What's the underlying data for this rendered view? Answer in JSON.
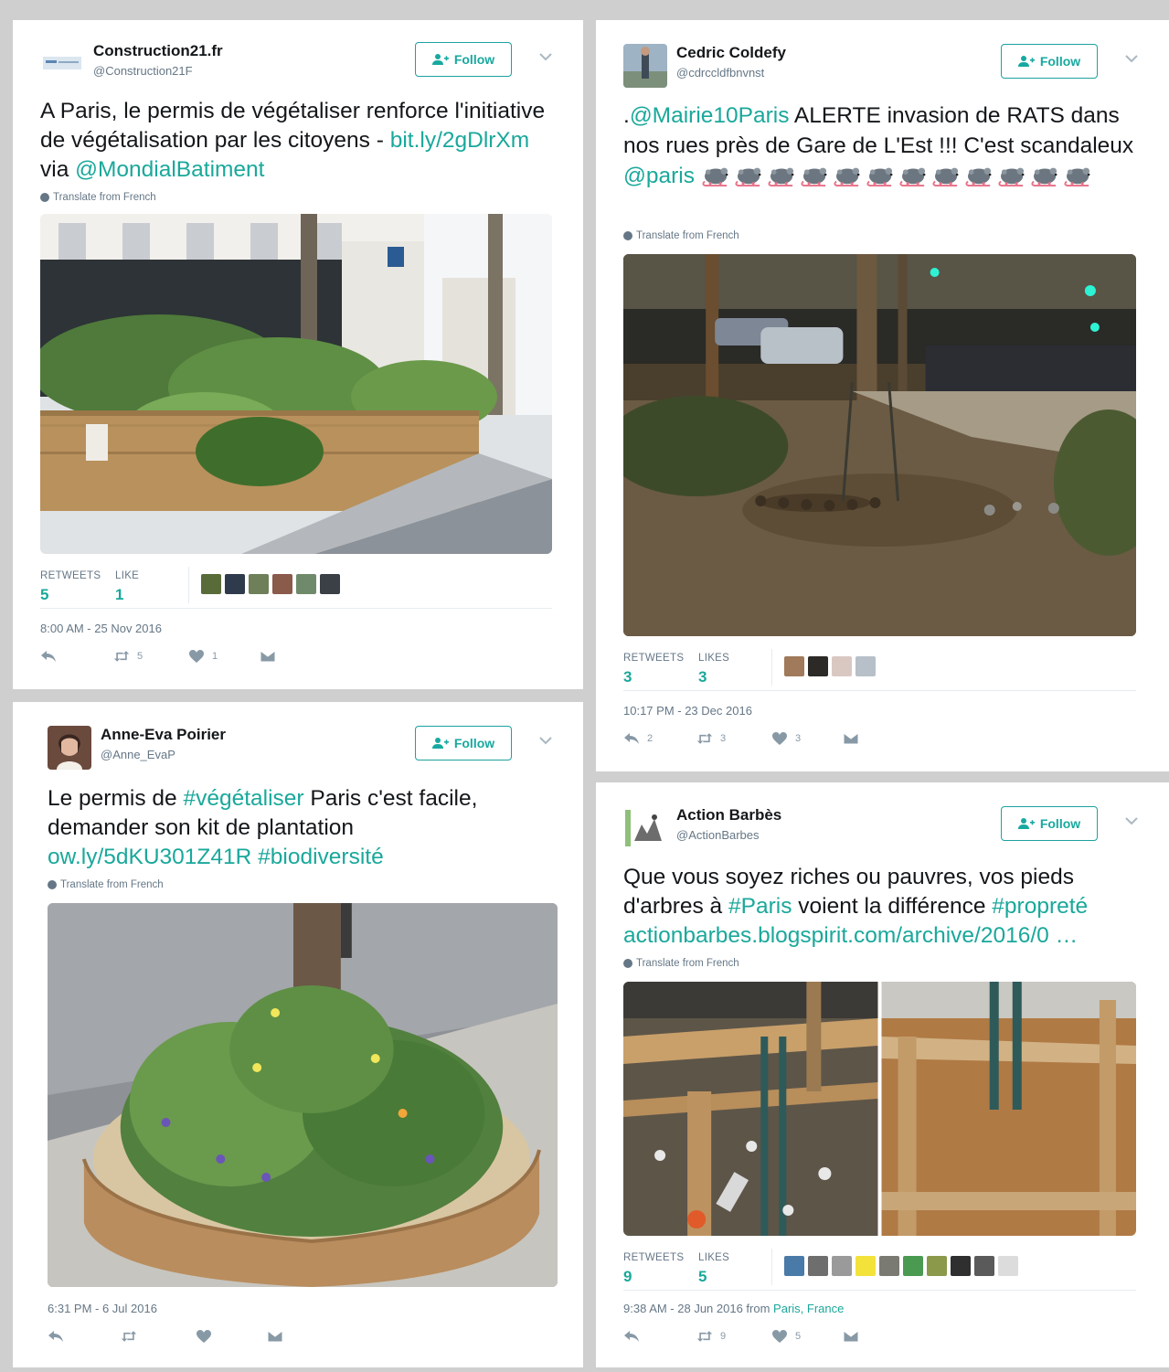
{
  "tweets": [
    {
      "name": "Construction21.fr",
      "handle": "@Construction21F",
      "follow_label": "Follow",
      "text_a": "A Paris, le permis de végétaliser renforce l'initiative de végétalisation par les citoyens - ",
      "link_1": "bit.ly/2gDlrXm",
      "text_b": " via ",
      "link_2": "@MondialBatiment",
      "translate_label": "Translate from French",
      "retweets_label": "RETWEETS",
      "retweets": "5",
      "likes_label": "LIKE",
      "likes": "1",
      "timestamp": "8:00 AM - 25 Nov 2016",
      "reply_count": "",
      "retweet_count": "5",
      "like_count": "1"
    },
    {
      "name": "Cedric Coldefy",
      "handle": "@cdrccldfbnvnst",
      "follow_label": "Follow",
      "text_lead": ".",
      "link_1": "@Mairie10Paris",
      "text_a": " ALERTE invasion de RATS dans nos rues près de Gare de L'Est !!! C'est scandaleux ",
      "link_2": "@paris",
      "rat_count": 12,
      "translate_label": "Translate from French",
      "retweets_label": "RETWEETS",
      "retweets": "3",
      "likes_label": "LIKES",
      "likes": "3",
      "timestamp": "10:17 PM - 23 Dec 2016",
      "reply_count": "2",
      "retweet_count": "3",
      "like_count": "3"
    },
    {
      "name": "Anne-Eva Poirier",
      "handle": "@Anne_EvaP",
      "follow_label": "Follow",
      "text_a": "Le permis de ",
      "link_1": "#végétaliser",
      "text_b": " Paris c'est facile, demander son kit de plantation ",
      "link_2": "ow.ly/5dKU301Z41R",
      "text_c": " ",
      "link_3": "#biodiversité",
      "translate_label": "Translate from French",
      "timestamp": "6:31 PM - 6 Jul 2016"
    },
    {
      "name": "Action Barbès",
      "handle": "@ActionBarbes",
      "follow_label": "Follow",
      "text_a": "Que vous soyez riches ou pauvres, vos pieds d'arbres à ",
      "link_1": "#Paris",
      "text_b": " voient la différence ",
      "link_2": "#propreté",
      "text_c": " ",
      "link_3": "actionbarbes.blogspirit.com/archive/2016/0 …",
      "translate_label": "Translate from French",
      "retweets_label": "RETWEETS",
      "retweets": "9",
      "likes_label": "LIKES",
      "likes": "5",
      "timestamp_a": "9:38 AM - 28 Jun 2016 from ",
      "location": "Paris, France",
      "reply_count": "",
      "retweet_count": "9",
      "like_count": "5"
    }
  ],
  "colors": {
    "accent": "#1aa89b",
    "muted": "#657786",
    "text": "#14171a",
    "like_red": "#e0245e"
  },
  "icons": [
    "follow-person-icon",
    "chevron-down-icon",
    "globe-icon",
    "reply-icon",
    "retweet-icon",
    "heart-icon",
    "dm-icon",
    "rat-emoji-icon"
  ]
}
